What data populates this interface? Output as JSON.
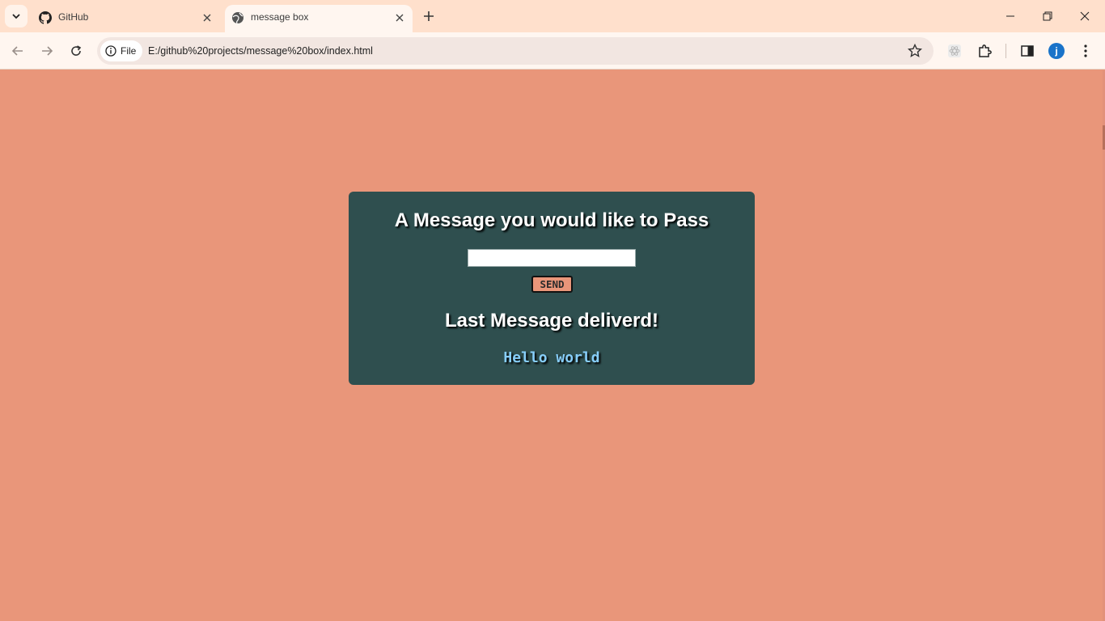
{
  "browser": {
    "tabs": [
      {
        "title": "GitHub",
        "icon": "github-icon",
        "active": false
      },
      {
        "title": "message box",
        "icon": "globe-icon",
        "active": true
      }
    ],
    "address": {
      "scheme_chip": "File",
      "url": "E:/github%20projects/message%20box/index.html"
    },
    "profile_initial": "j"
  },
  "page": {
    "background_color": "#e9967a",
    "card_color": "#2f4f4f",
    "heading": "A Message you would like to Pass",
    "input": {
      "value": "",
      "placeholder": ""
    },
    "send_label": "SEND",
    "subheading": "Last Message deliverd!",
    "last_message": "Hello world"
  }
}
